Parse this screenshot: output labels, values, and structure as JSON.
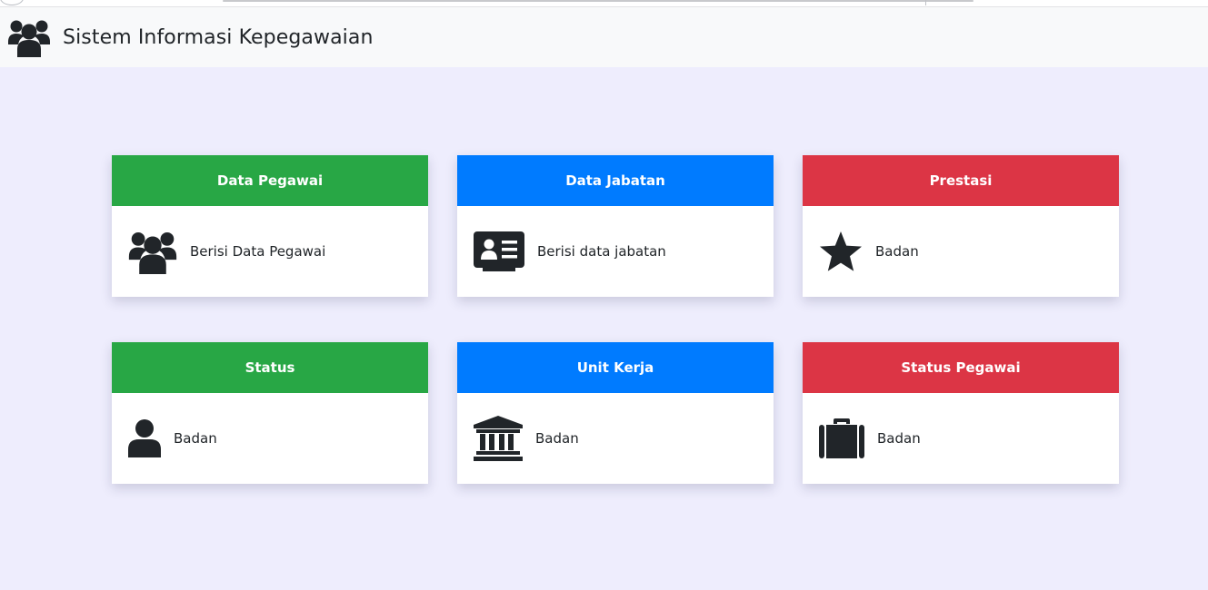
{
  "app": {
    "title": "Sistem Informasi Kepegawaian",
    "logo_icon": "users-icon"
  },
  "colors": {
    "background": "#eeedfd",
    "navbar": "#f8f9fa",
    "green": "#28a745",
    "blue": "#007bff",
    "red": "#dc3545",
    "icon": "#212529"
  },
  "cards": [
    {
      "title": "Data Pegawai",
      "text": "Berisi Data Pegawai",
      "icon": "users-icon",
      "color": "green"
    },
    {
      "title": "Data Jabatan",
      "text": "Berisi data jabatan",
      "icon": "id-card-icon",
      "color": "blue"
    },
    {
      "title": "Prestasi",
      "text": "Badan",
      "icon": "star-icon",
      "color": "red"
    },
    {
      "title": "Status",
      "text": "Badan",
      "icon": "user-icon",
      "color": "green"
    },
    {
      "title": "Unit Kerja",
      "text": "Badan",
      "icon": "university-icon",
      "color": "blue"
    },
    {
      "title": "Status Pegawai",
      "text": "Badan",
      "icon": "briefcase-icon",
      "color": "red"
    }
  ]
}
